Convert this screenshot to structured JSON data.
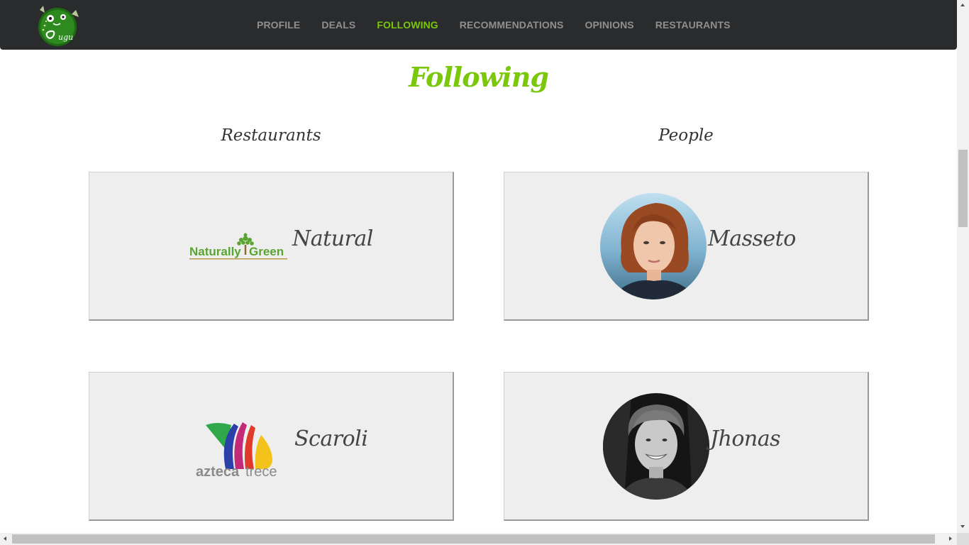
{
  "nav": {
    "items": [
      {
        "label": "PROFILE",
        "active": false
      },
      {
        "label": "DEALS",
        "active": false
      },
      {
        "label": "FOLLOWING",
        "active": true
      },
      {
        "label": "RECOMMENDATIONS",
        "active": false
      },
      {
        "label": "OPINIONS",
        "active": false
      },
      {
        "label": "RESTAURANTS",
        "active": false
      }
    ],
    "logo_icon": "monster-mascot-logo",
    "logo_text": "ugu"
  },
  "page": {
    "title": "Following"
  },
  "restaurants": {
    "heading": "Restaurants",
    "items": [
      {
        "name": "Natural",
        "logo_icon": "naturally-green-logo",
        "logo_text_1": "Naturally",
        "logo_text_2": "Green"
      },
      {
        "name": "Scaroli",
        "logo_icon": "azteca-trece-logo",
        "logo_text_1": "azteca",
        "logo_text_2": "trece"
      }
    ]
  },
  "people": {
    "heading": "People",
    "items": [
      {
        "name": "Masseto",
        "avatar_icon": "person-photo"
      },
      {
        "name": "Jhonas",
        "avatar_icon": "person-photo"
      }
    ]
  },
  "colors": {
    "accent": "#7ac70c",
    "navbar": "#2a2b2d",
    "card_bg": "#eeeeee"
  }
}
